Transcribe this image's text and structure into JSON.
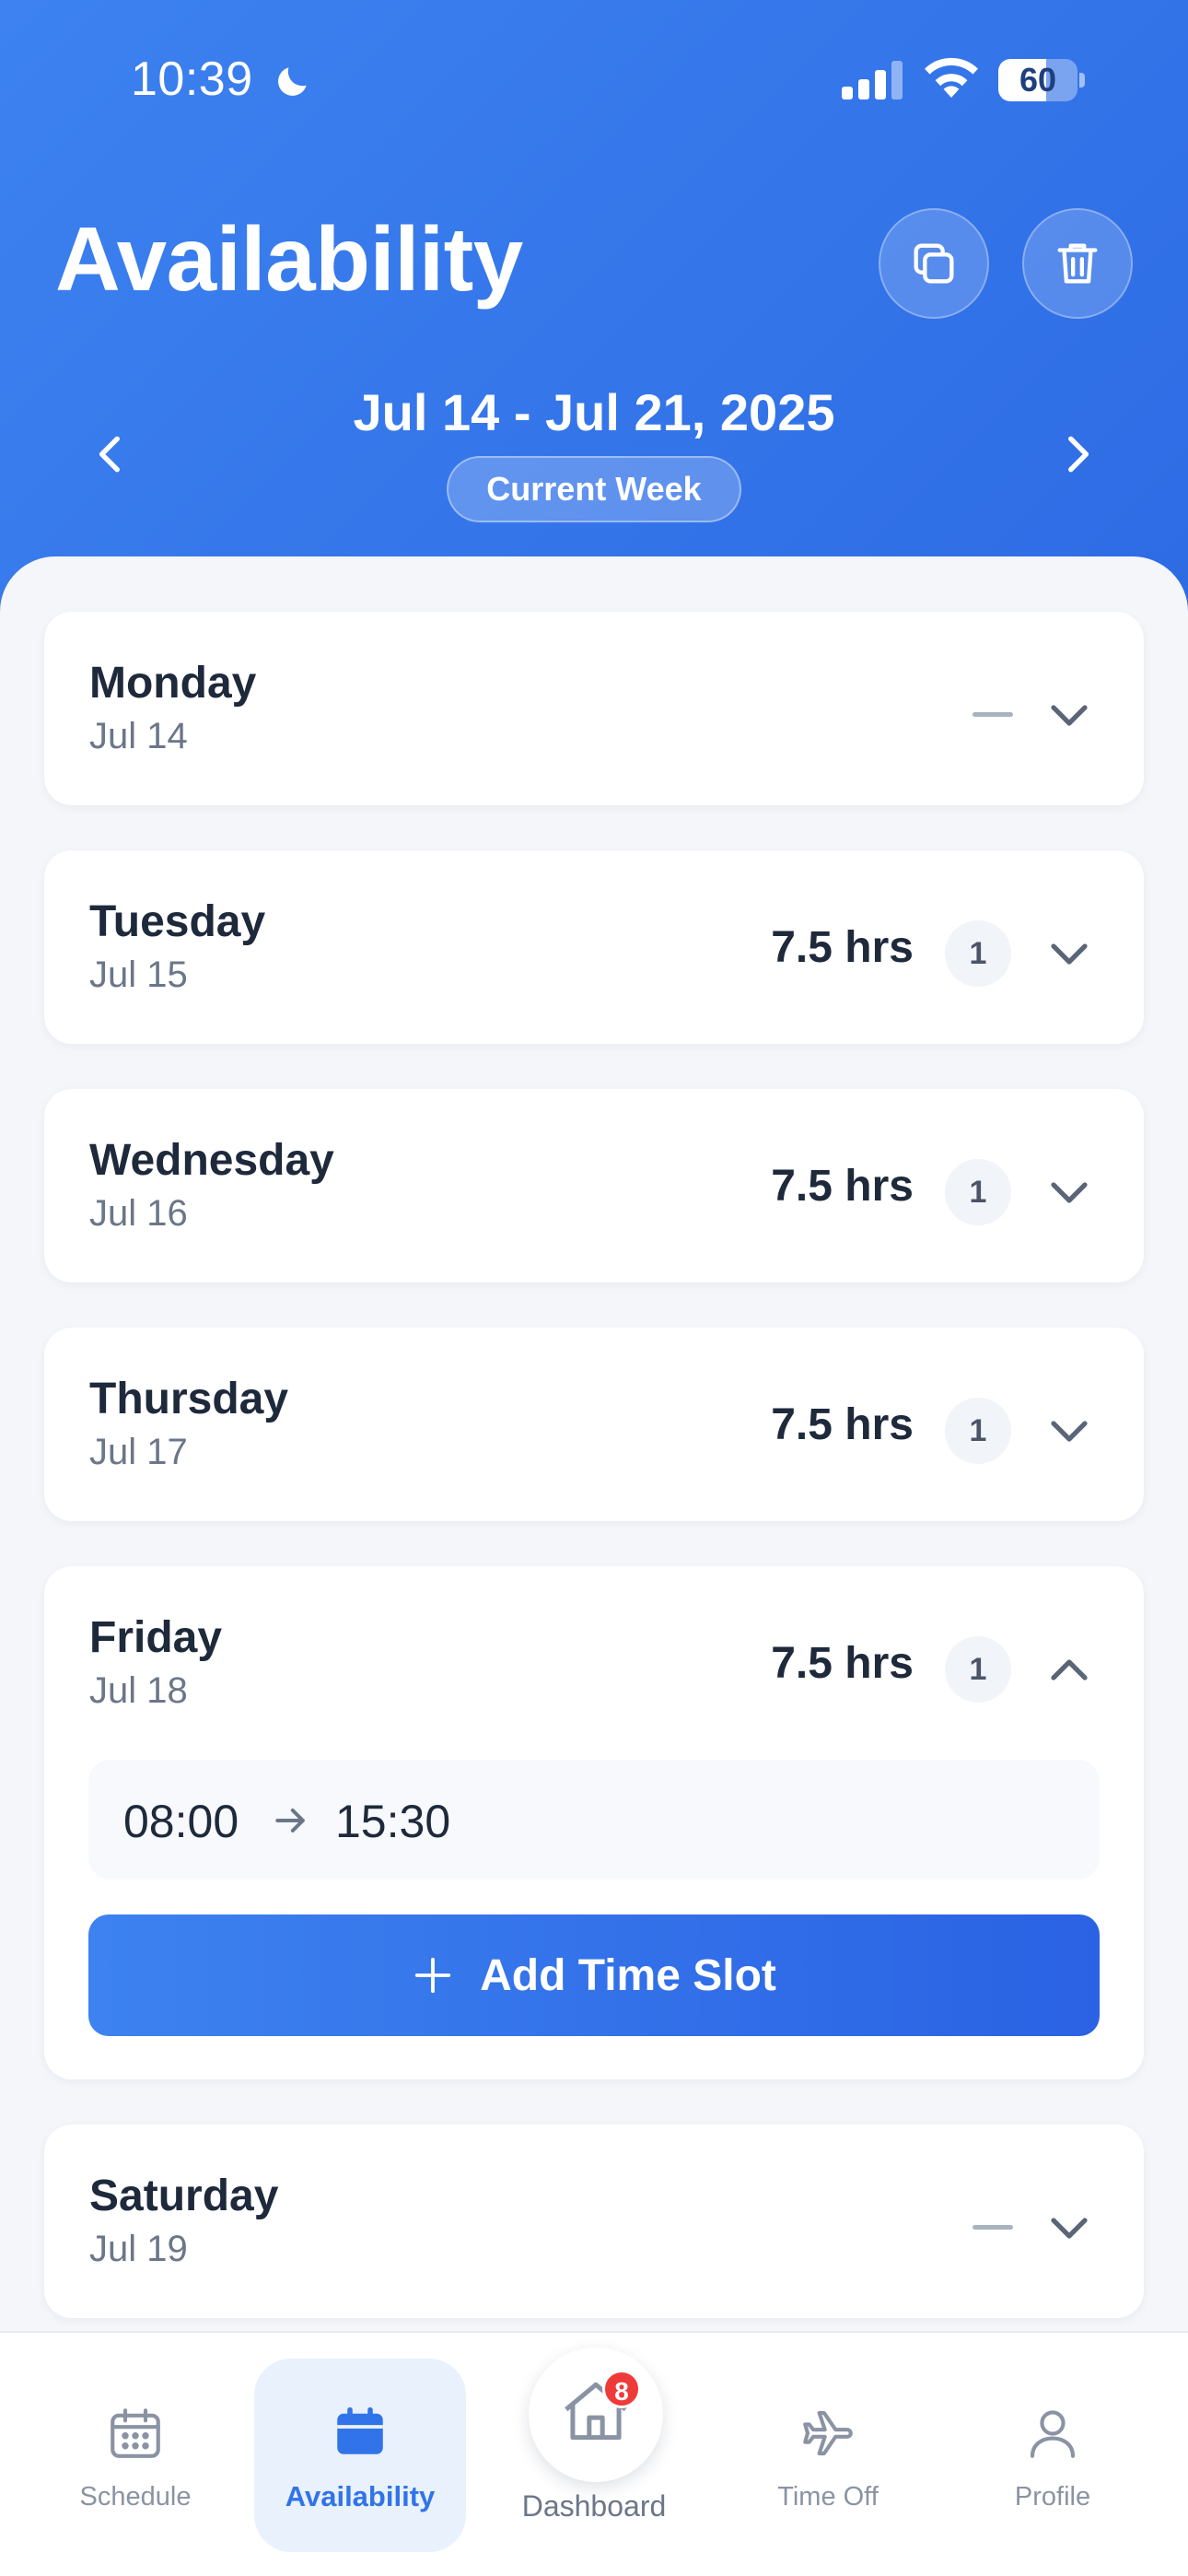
{
  "status_bar": {
    "time": "10:39",
    "battery_level": "60",
    "battery_fraction": 0.6
  },
  "header": {
    "title": "Availability",
    "week_range": "Jul 14 - Jul 21, 2025",
    "week_badge": "Current Week"
  },
  "days": [
    {
      "name": "Monday",
      "date": "Jul 14",
      "hours": "",
      "slots": "",
      "expanded": false
    },
    {
      "name": "Tuesday",
      "date": "Jul 15",
      "hours": "7.5 hrs",
      "slots": "1",
      "expanded": false
    },
    {
      "name": "Wednesday",
      "date": "Jul 16",
      "hours": "7.5 hrs",
      "slots": "1",
      "expanded": false
    },
    {
      "name": "Thursday",
      "date": "Jul 17",
      "hours": "7.5 hrs",
      "slots": "1",
      "expanded": false
    },
    {
      "name": "Friday",
      "date": "Jul 18",
      "hours": "7.5 hrs",
      "slots": "1",
      "expanded": true,
      "time_slots": [
        {
          "start": "08:00",
          "end": "15:30"
        }
      ],
      "add_slot_label": "Add Time Slot"
    },
    {
      "name": "Saturday",
      "date": "Jul 19",
      "hours": "",
      "slots": "",
      "expanded": false
    }
  ],
  "tabbar": {
    "schedule": "Schedule",
    "availability": "Availability",
    "dashboard": "Dashboard",
    "dashboard_badge": "8",
    "time_off": "Time Off",
    "profile": "Profile"
  },
  "colors": {
    "header_gradient_start": "#3d82f0",
    "header_gradient_end": "#2d6be4",
    "accent": "#3173e8",
    "badge_red": "#ef3a3a",
    "text_dark": "#1e293b",
    "text_muted": "#6b7688"
  },
  "icons": {
    "copy": "copy-icon",
    "delete": "trash-icon",
    "prev": "chevron-left-icon",
    "next": "chevron-right-icon",
    "expand": "chevron-down-icon",
    "collapse": "chevron-up-icon",
    "slot_arrow": "arrow-right-icon",
    "add": "plus-icon",
    "schedule": "calendar-grid-icon",
    "availability": "calendar-icon",
    "dashboard": "home-icon",
    "time_off": "airplane-icon",
    "profile": "user-icon"
  }
}
